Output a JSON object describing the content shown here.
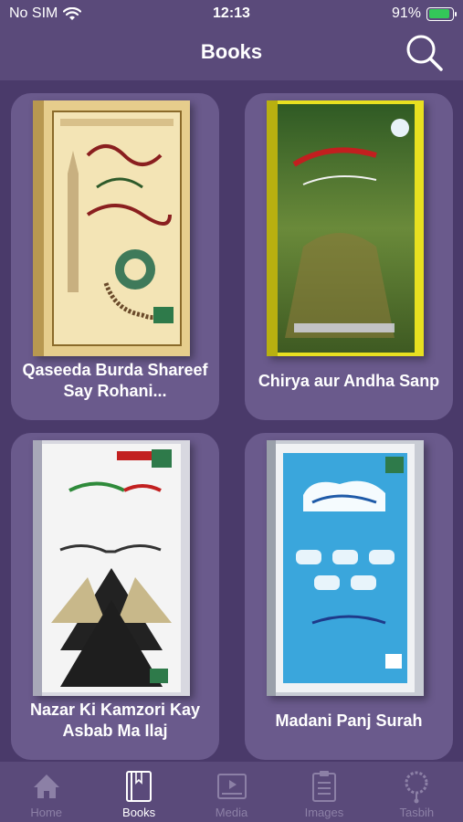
{
  "status": {
    "carrier": "No SIM",
    "time": "12:13",
    "battery": "91%"
  },
  "header": {
    "title": "Books"
  },
  "books": [
    {
      "title": "Qaseeda Burda Shareef Say Rohani..."
    },
    {
      "title": "Chirya aur Andha Sanp"
    },
    {
      "title": "Nazar Ki Kamzori Kay Asbab Ma Ilaj"
    },
    {
      "title": "Madani Panj Surah"
    }
  ],
  "tabs": [
    {
      "label": "Home",
      "icon": "home-icon"
    },
    {
      "label": "Books",
      "icon": "book-icon",
      "active": true
    },
    {
      "label": "Media",
      "icon": "media-icon"
    },
    {
      "label": "Images",
      "icon": "images-icon"
    },
    {
      "label": "Tasbih",
      "icon": "tasbih-icon"
    }
  ],
  "colors": {
    "background": "#4a3a6a",
    "bar": "#5a4a7a",
    "card": "#6a5a8c",
    "battery": "#34c759"
  }
}
